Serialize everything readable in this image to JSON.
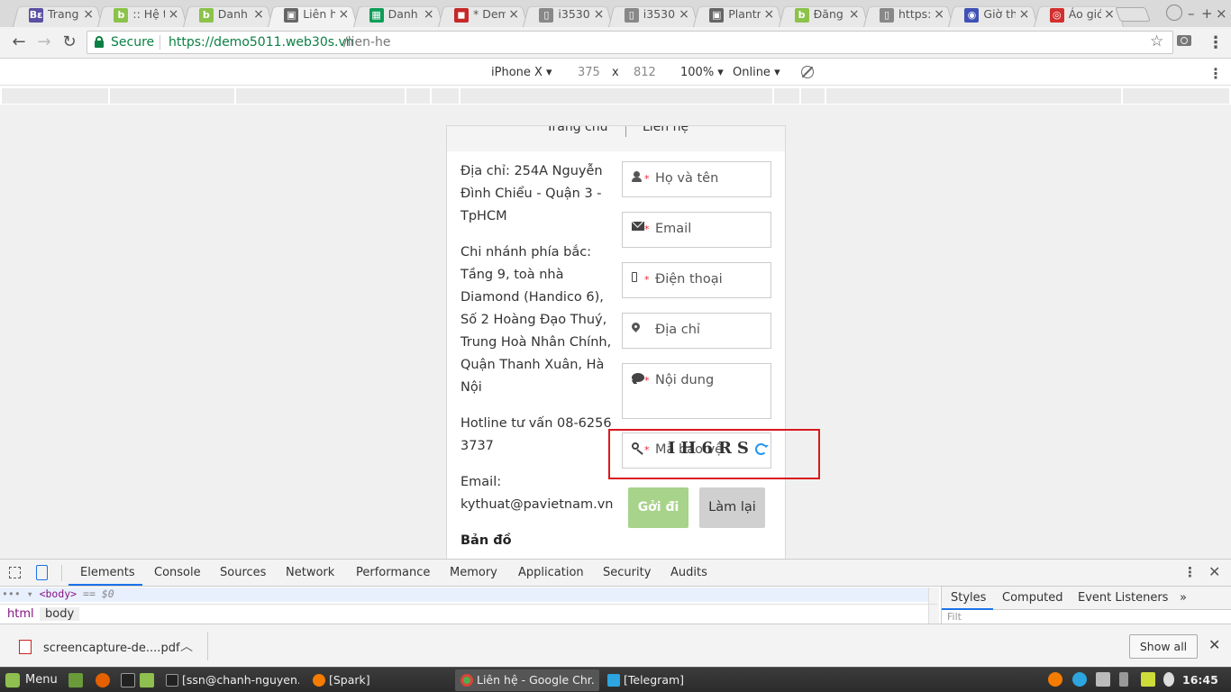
{
  "browser": {
    "tabs": [
      {
        "title": "Trang",
        "favicon_text": "Bε",
        "favicon_color": "#5a4fa3"
      },
      {
        "title": ":: Hệ th",
        "favicon_text": "b",
        "favicon_color": "#8bc34a"
      },
      {
        "title": "Danh",
        "favicon_text": "b",
        "favicon_color": "#8bc34a"
      },
      {
        "title": "Liên hệ",
        "favicon_text": "▣",
        "favicon_color": "#666666"
      },
      {
        "title": "Danh",
        "favicon_text": "▦",
        "favicon_color": "#0f9d58"
      },
      {
        "title": "* Dem",
        "favicon_text": "◼",
        "favicon_color": "#c62828"
      },
      {
        "title": "i3530",
        "favicon_text": "▯",
        "favicon_color": "#888888"
      },
      {
        "title": "i3530",
        "favicon_text": "▯",
        "favicon_color": "#888888"
      },
      {
        "title": "Plantn",
        "favicon_text": "▣",
        "favicon_color": "#666666"
      },
      {
        "title": "Đăng",
        "favicon_text": "b",
        "favicon_color": "#8bc34a"
      },
      {
        "title": "https:/",
        "favicon_text": "▯",
        "favicon_color": "#888888"
      },
      {
        "title": "Giờ th",
        "favicon_text": "◉",
        "favicon_color": "#3f51b5"
      },
      {
        "title": "Áo gió",
        "favicon_text": "◎",
        "favicon_color": "#d32f2f"
      }
    ],
    "active_tab_index": 3,
    "secure_label": "Secure",
    "url_host": "https://demo5011.web30s.vn",
    "url_path": "/lien-he"
  },
  "device_toolbar": {
    "device": "iPhone X",
    "width": "375",
    "times": "x",
    "height": "812",
    "zoom": "100%",
    "network": "Online"
  },
  "page": {
    "nav": {
      "home": "Trang chủ",
      "contact": "Liên hệ"
    },
    "info": {
      "address": "Địa chỉ: 254A Nguyễn Đình Chiểu - Quận 3 - TpHCM",
      "branch": "Chi nhánh phía bắc: Tầng 9, toà nhà Diamond (Handico 6), Số 2 Hoàng Đạo Thuý, Trung Hoà Nhân Chính, Quận Thanh Xuân, Hà Nội",
      "hotline": "Hotline tư vấn 08-6256 3737",
      "email_label": "Email:",
      "email": "kythuat@pavietnam.vn"
    },
    "map_title": "Bản đồ",
    "form": {
      "required_mark": "*",
      "name": "Họ và tên",
      "email": "Email",
      "phone": "Điện thoại",
      "address": "Địa chỉ",
      "message": "Nội dung",
      "captcha_placeholder": "Mã bảo vệ",
      "captcha_code": "IH6RS",
      "send_button": "Gởi đi",
      "reset_button": "Làm lại"
    }
  },
  "devtools": {
    "tabs": [
      "Elements",
      "Console",
      "Sources",
      "Network",
      "Performance",
      "Memory",
      "Application",
      "Security",
      "Audits"
    ],
    "active_tab": "Elements",
    "dom_line_prefix": "•••",
    "dom_line_tag": "<body>",
    "dom_line_suffix": "== $0",
    "breadcrumbs": [
      "html",
      "body"
    ],
    "side_tabs": [
      "Styles",
      "Computed",
      "Event Listeners"
    ],
    "side_more": "»",
    "filter_placeholder": "Filt"
  },
  "download_shelf": {
    "filename": "screencapture-de....pdf",
    "show_all": "Show all"
  },
  "taskbar": {
    "menu_label": "Menu",
    "windows": [
      {
        "title": "[ssn@chanh-nguyen...",
        "icon_color": "#222222"
      },
      {
        "title": "[Spark]",
        "icon_color": "#f57c00"
      },
      {
        "title": "Liên hệ - Google Chr...",
        "icon_color": "#4caf50"
      },
      {
        "title": "[Telegram]",
        "icon_color": "#2ca5e0"
      }
    ],
    "clock": "16:45"
  }
}
